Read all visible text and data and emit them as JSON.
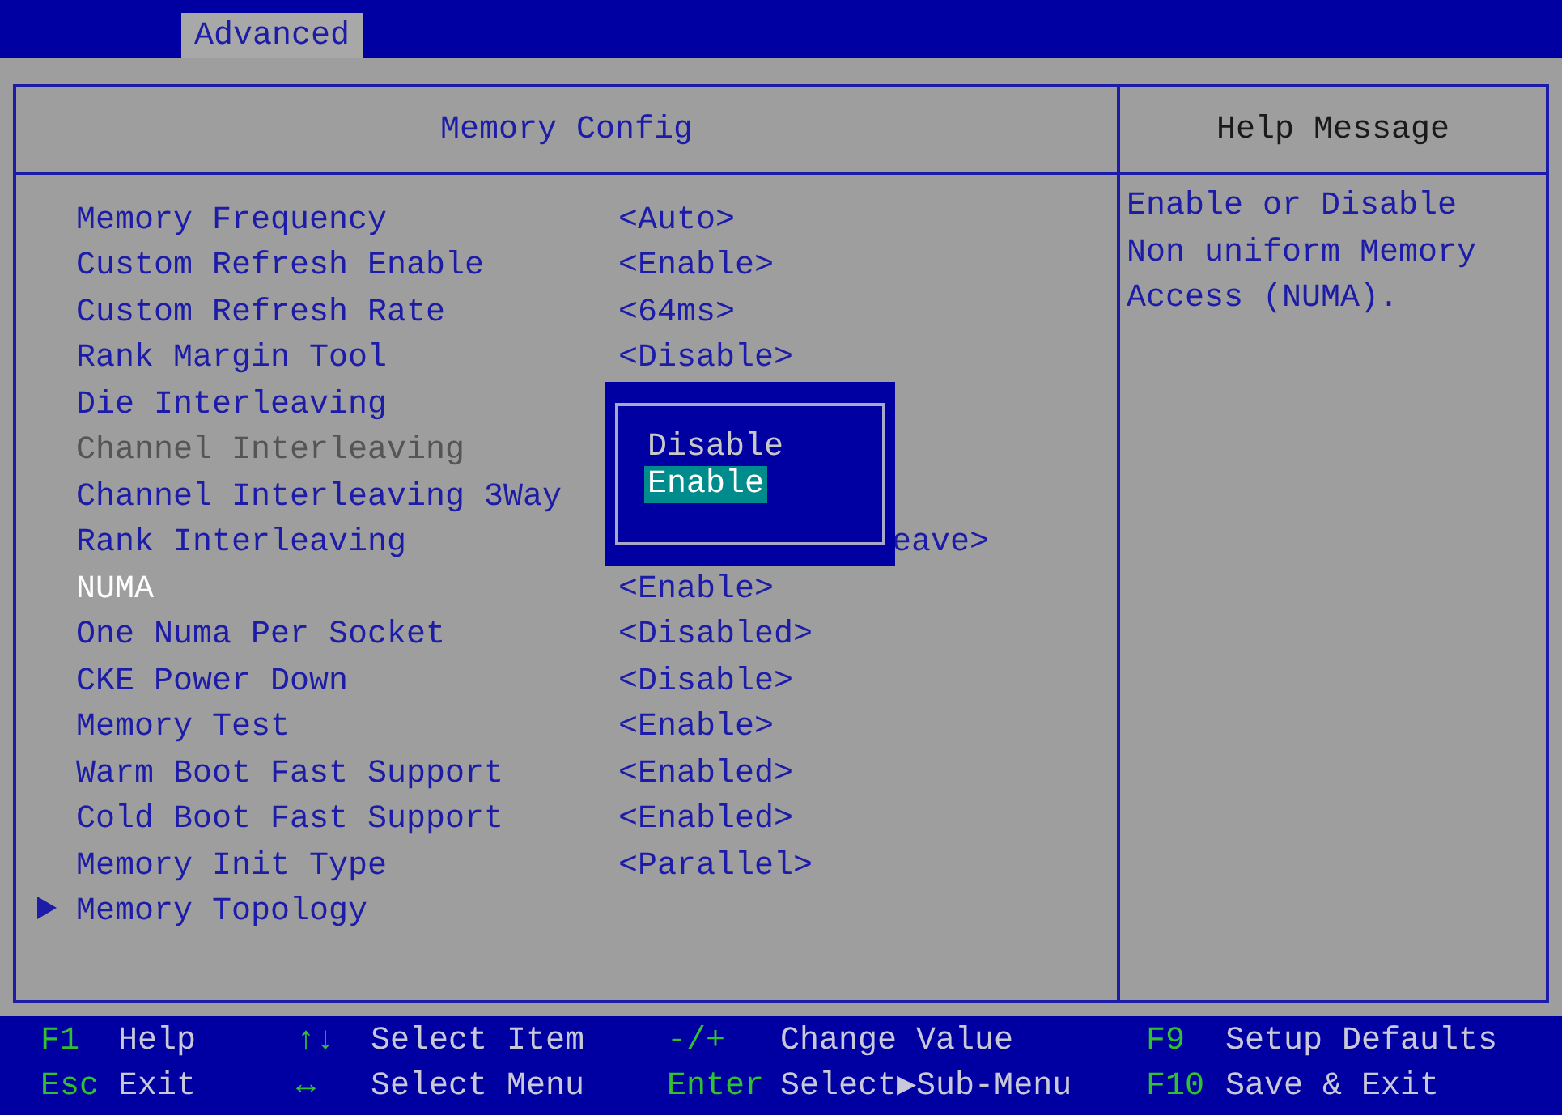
{
  "tabs": [
    {
      "label": "Advanced",
      "selected": true
    }
  ],
  "panel": {
    "title": "Memory Config",
    "rows": [
      {
        "kind": "item",
        "label": "Memory Frequency",
        "value": "<Auto>",
        "selected": false,
        "disabled": false
      },
      {
        "kind": "item",
        "label": "Custom Refresh Enable",
        "value": "<Enable>",
        "selected": false,
        "disabled": false
      },
      {
        "kind": "item",
        "label": "Custom Refresh Rate",
        "value": "<64ms>",
        "selected": false,
        "disabled": false
      },
      {
        "kind": "item",
        "label": "Rank Margin Tool",
        "value": "<Disable>",
        "selected": false,
        "disabled": false
      },
      {
        "kind": "item",
        "label": "Die Interleaving",
        "selected": false,
        "disabled": false
      },
      {
        "kind": "item",
        "label": "Channel Interleaving",
        "selected": false,
        "disabled": true
      },
      {
        "kind": "item",
        "label": "Channel Interleaving 3Way",
        "selected": false,
        "disabled": false
      },
      {
        "kind": "item",
        "label": "Rank Interleaving",
        "value": "eave>",
        "selected": false,
        "disabled": false,
        "covered": true
      },
      {
        "kind": "item",
        "label": "NUMA",
        "value": "<Enable>",
        "selected": true,
        "disabled": false
      },
      {
        "kind": "item",
        "label": "One Numa Per Socket",
        "value": "<Disabled>",
        "selected": false,
        "disabled": false
      },
      {
        "kind": "item",
        "label": "CKE Power Down",
        "value": "<Disable>",
        "selected": false,
        "disabled": false
      },
      {
        "kind": "item",
        "label": "Memory Test",
        "value": "<Enable>",
        "selected": false,
        "disabled": false
      },
      {
        "kind": "item",
        "label": "Warm Boot Fast Support",
        "value": "<Enabled>",
        "selected": false,
        "disabled": false
      },
      {
        "kind": "item",
        "label": "Cold Boot Fast Support",
        "value": "<Enabled>",
        "selected": false,
        "disabled": false
      },
      {
        "kind": "item",
        "label": "Memory Init Type",
        "value": "<Parallel>",
        "selected": false,
        "disabled": false
      },
      {
        "kind": "submenu",
        "label": "Memory Topology",
        "selected": false,
        "disabled": false
      }
    ]
  },
  "popup": {
    "options": [
      {
        "label": "Disable",
        "selected": false
      },
      {
        "label": "Enable",
        "selected": true
      }
    ]
  },
  "help": {
    "title": "Help Message",
    "text": "Enable or Disable Non uniform Memory Access (NUMA)."
  },
  "hints": [
    {
      "key": "F1",
      "label": "Help"
    },
    {
      "key": "↑↓",
      "label": "Select Item"
    },
    {
      "key": "-/+",
      "label": "Change Value"
    },
    {
      "key": "F9",
      "label": "Setup Defaults"
    },
    {
      "key": "Esc",
      "label": "Exit"
    },
    {
      "key": "↔",
      "label": "Select Menu"
    },
    {
      "key": "Enter",
      "label": "Select▶Sub-Menu"
    },
    {
      "key": "F10",
      "label": "Save & Exit"
    }
  ]
}
